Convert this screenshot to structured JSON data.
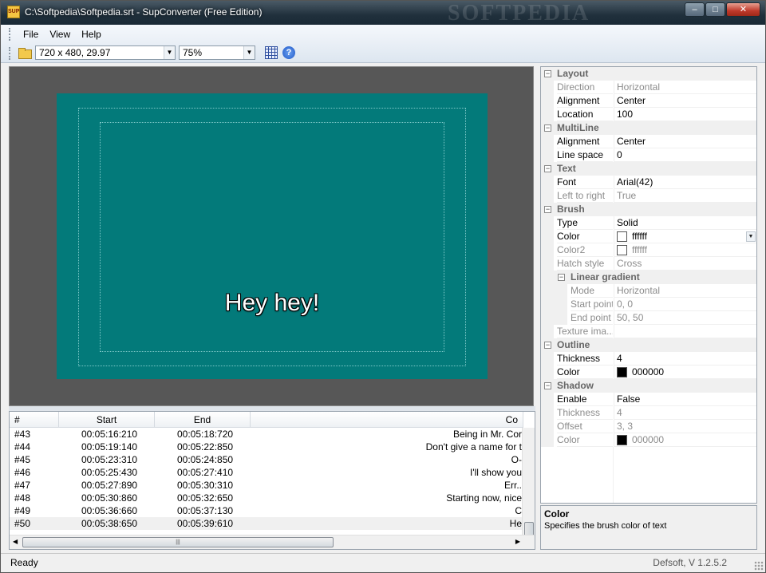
{
  "window": {
    "title": "C:\\Softpedia\\Softpedia.srt - SupConverter (Free Edition)",
    "icon_label": "SUP",
    "watermark": "SOFTPEDIA",
    "controls": {
      "minimize": "–",
      "maximize": "□",
      "close": "✕"
    }
  },
  "menu": {
    "items": [
      {
        "name": "file",
        "label": "File"
      },
      {
        "name": "view",
        "label": "View"
      },
      {
        "name": "help",
        "label": "Help"
      }
    ]
  },
  "toolbar": {
    "resolution": "720 x 480, 29.97",
    "zoom": "75%",
    "icons": [
      "folder-open-icon",
      "grid-icon",
      "help-icon"
    ],
    "help_glyph": "?"
  },
  "preview": {
    "text": "Hey hey!",
    "canvas_color": "#037a7a",
    "background_color": "#575757"
  },
  "list": {
    "columns": {
      "num": "#",
      "start": "Start",
      "end": "End",
      "content": "Co"
    },
    "rows": [
      {
        "num": "#43",
        "start": "00:05:16:210",
        "end": "00:05:18:720",
        "content": "Being in Mr. Cor"
      },
      {
        "num": "#44",
        "start": "00:05:19:140",
        "end": "00:05:22:850",
        "content": "Don't give a name for t"
      },
      {
        "num": "#45",
        "start": "00:05:23:310",
        "end": "00:05:24:850",
        "content": "O-"
      },
      {
        "num": "#46",
        "start": "00:05:25:430",
        "end": "00:05:27:410",
        "content": "I'll show you"
      },
      {
        "num": "#47",
        "start": "00:05:27:890",
        "end": "00:05:30:310",
        "content": "Err.."
      },
      {
        "num": "#48",
        "start": "00:05:30:860",
        "end": "00:05:32:650",
        "content": "Starting now, nice"
      },
      {
        "num": "#49",
        "start": "00:05:36:660",
        "end": "00:05:37:130",
        "content": "C"
      },
      {
        "num": "#50",
        "start": "00:05:38:650",
        "end": "00:05:39:610",
        "content": "He"
      }
    ]
  },
  "properties": {
    "rows": [
      {
        "kind": "cat",
        "label": "Layout"
      },
      {
        "kind": "prop",
        "name": "Direction",
        "value": "Horizontal",
        "dim": true
      },
      {
        "kind": "prop",
        "name": "Alignment",
        "value": "Center"
      },
      {
        "kind": "prop",
        "name": "Location",
        "value": "100"
      },
      {
        "kind": "cat",
        "label": "MultiLine"
      },
      {
        "kind": "prop",
        "name": "Alignment",
        "value": "Center"
      },
      {
        "kind": "prop",
        "name": "Line space",
        "value": "0"
      },
      {
        "kind": "cat",
        "label": "Text"
      },
      {
        "kind": "prop",
        "name": "Font",
        "value": "Arial(42)"
      },
      {
        "kind": "prop",
        "name": "Left to right",
        "value": "True",
        "dim": true
      },
      {
        "kind": "cat",
        "label": "Brush"
      },
      {
        "kind": "prop",
        "name": "Type",
        "value": "Solid"
      },
      {
        "kind": "prop",
        "name": "Color",
        "value": "ffffff",
        "swatch": "#ffffff",
        "selected": true
      },
      {
        "kind": "prop",
        "name": "Color2",
        "value": "ffffff",
        "swatch": "#ffffff",
        "dim": true
      },
      {
        "kind": "prop",
        "name": "Hatch style",
        "value": "Cross",
        "dim": true
      },
      {
        "kind": "subcat",
        "label": "Linear gradient"
      },
      {
        "kind": "prop",
        "name": "Mode",
        "value": "Horizontal",
        "dim": true,
        "indent": true
      },
      {
        "kind": "prop",
        "name": "Start point",
        "value": "0, 0",
        "dim": true,
        "indent": true
      },
      {
        "kind": "prop",
        "name": "End point",
        "value": "50, 50",
        "dim": true,
        "indent": true
      },
      {
        "kind": "prop",
        "name": "Texture ima...",
        "value": "",
        "dim": true
      },
      {
        "kind": "cat",
        "label": "Outline"
      },
      {
        "kind": "prop",
        "name": "Thickness",
        "value": "4"
      },
      {
        "kind": "prop",
        "name": "Color",
        "value": "000000",
        "swatch": "#000000"
      },
      {
        "kind": "cat",
        "label": "Shadow"
      },
      {
        "kind": "prop",
        "name": "Enable",
        "value": "False"
      },
      {
        "kind": "prop",
        "name": "Thickness",
        "value": "4",
        "dim": true
      },
      {
        "kind": "prop",
        "name": "Offset",
        "value": "3, 3",
        "dim": true
      },
      {
        "kind": "prop",
        "name": "Color",
        "value": "000000",
        "swatch": "#000000",
        "dim": true
      }
    ]
  },
  "description": {
    "title": "Color",
    "text": "Specifies the brush color of text"
  },
  "status": {
    "text": "Ready",
    "version": "Defsoft, V 1.2.5.2"
  }
}
